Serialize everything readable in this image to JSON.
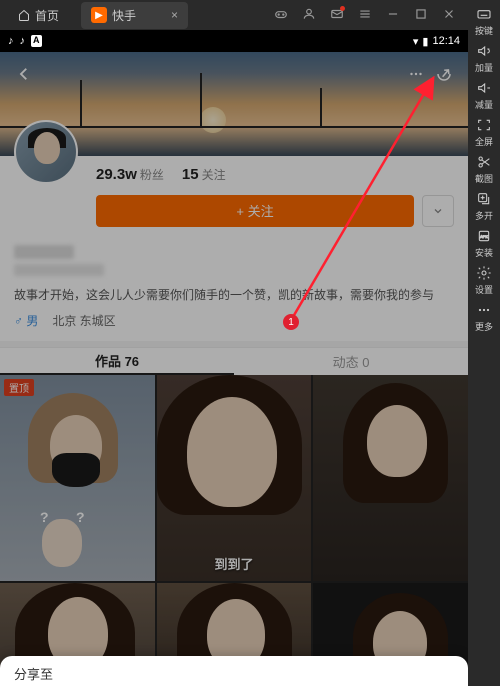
{
  "titlebar": {
    "home_label": "首页",
    "active_tab": "快手",
    "close_glyph": "×"
  },
  "status": {
    "time": "12:14"
  },
  "profile": {
    "fans_count": "29.3w",
    "fans_label": "粉丝",
    "follow_count": "15",
    "follow_label": "关注",
    "follow_btn": "+ 关注",
    "bio": "故事才开始，这会儿人少需要你们随手的一个赞，凯的新故事，需要你我的参与",
    "gender": "♂ 男",
    "location": "北京 东城区"
  },
  "tabs": {
    "works": "作品 76",
    "moments": "动态 0"
  },
  "grid": {
    "badge_pinned": "置顶",
    "caption2": "到到了"
  },
  "annotation": {
    "marker": "1"
  },
  "sheet": {
    "title": "分享至"
  },
  "toolbar": {
    "keyboard": "按键",
    "volup": "加量",
    "voldown": "减量",
    "fullscreen": "全屏",
    "screenshot": "截图",
    "multiopen": "多开",
    "install": "安装",
    "settings": "设置",
    "more": "更多"
  }
}
